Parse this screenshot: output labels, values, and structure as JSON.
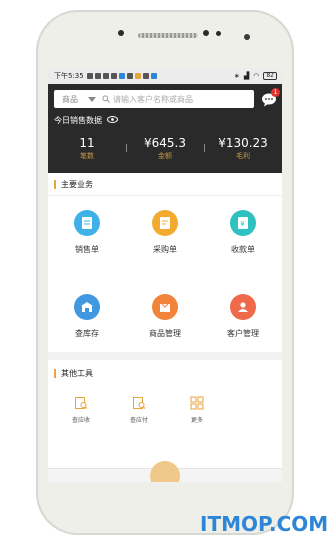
{
  "status_bar": {
    "time": "下午5:35",
    "battery": "82"
  },
  "search": {
    "category": "商品",
    "placeholder": "请输入客户名称或商品",
    "icon": "search-icon"
  },
  "messages": {
    "badge": "1",
    "icon": "chat-bubble-icon"
  },
  "sales": {
    "title": "今日销售数据",
    "stats": [
      {
        "value": "11",
        "label": "笔数"
      },
      {
        "value": "¥645.3",
        "label": "金额"
      },
      {
        "value": "¥130.23",
        "label": "毛利"
      }
    ]
  },
  "main_business": {
    "title": "主要业务",
    "items": [
      {
        "label": "销售单",
        "icon": "sales-order-icon",
        "color": "#3fb1e8"
      },
      {
        "label": "采购单",
        "icon": "purchase-order-icon",
        "color": "#f3ab2f"
      },
      {
        "label": "收款单",
        "icon": "receipt-icon",
        "color": "#2fc0c0"
      },
      {
        "label": "查库存",
        "icon": "warehouse-icon",
        "color": "#3f98e0"
      },
      {
        "label": "商品管理",
        "icon": "product-icon",
        "color": "#f2833a"
      },
      {
        "label": "客户管理",
        "icon": "customer-icon",
        "color": "#ef6a4a"
      }
    ]
  },
  "other_tools": {
    "title": "其他工具",
    "items": [
      {
        "label": "查应收",
        "icon": "receivable-icon"
      },
      {
        "label": "查应付",
        "icon": "payable-icon"
      },
      {
        "label": "更多",
        "icon": "grid-icon"
      }
    ]
  },
  "colors": {
    "accent": "#e8a33a",
    "dark_header": "#2a2a2a"
  },
  "watermark": "ITMOP.COM"
}
